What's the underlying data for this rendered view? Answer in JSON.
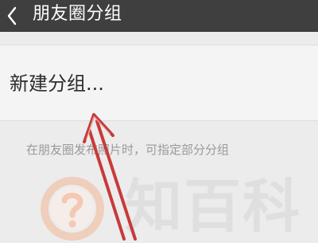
{
  "header": {
    "back_icon": "chevron-left-icon",
    "title": "朋友圈分组"
  },
  "content": {
    "new_group_label": "新建分组...",
    "hint": "在朋友圈发布照片时，可指定部分分组"
  },
  "watermark": {
    "logo_icon": "question-circle-icon",
    "text": "知百科"
  },
  "colors": {
    "header_background": "#3f3f3f",
    "page_background": "#ececec",
    "card_background": "#f4f4f4",
    "arrow": "#c83a3a",
    "watermark_orange": "#f4a57b"
  }
}
